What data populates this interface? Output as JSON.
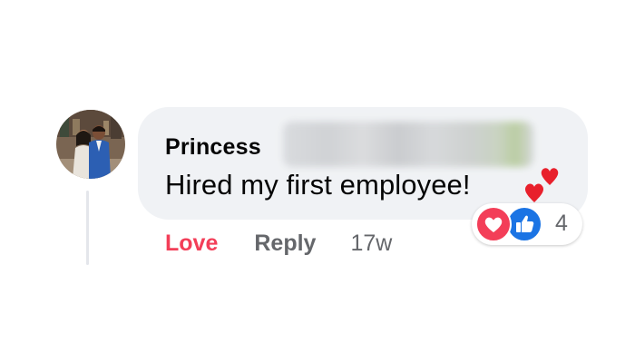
{
  "comment": {
    "author": "Princess",
    "author_surname_blurred": true,
    "text": "Hired my first employee!",
    "sticker_icon": "double-hearts-icon",
    "reactions": {
      "icons": [
        "love-reaction-icon",
        "like-reaction-icon"
      ],
      "count": "4"
    },
    "actions": {
      "reaction_label": "Love",
      "reply_label": "Reply",
      "timestamp": "17w"
    }
  },
  "colors": {
    "bubble": "#f0f2f5",
    "love": "#f33e58",
    "like": "#1b74e4",
    "secondary_text": "#65676b",
    "primary_text": "#050505"
  }
}
